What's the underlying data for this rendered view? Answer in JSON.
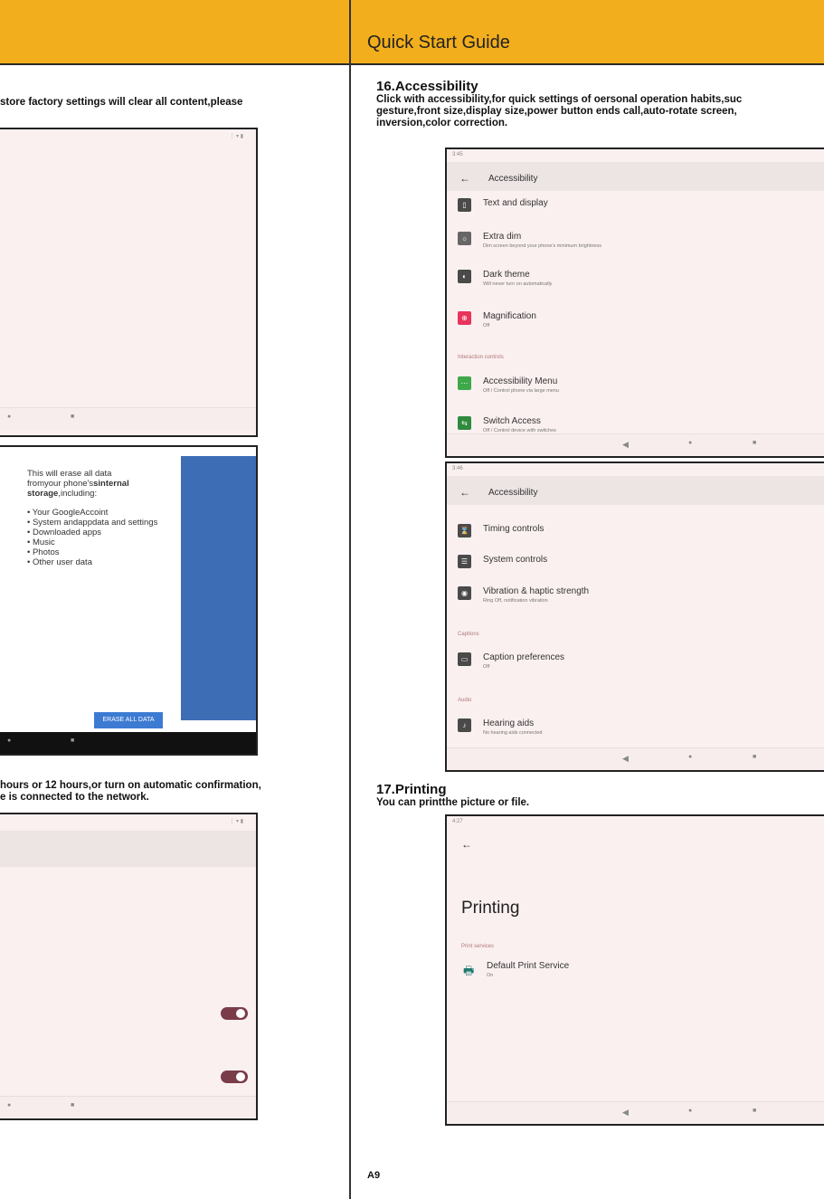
{
  "header": {
    "right_title": "Quick Start Guide"
  },
  "left": {
    "top_text": "store factory settings will clear all content,please",
    "erase": {
      "intro_line1": "This will erase all data",
      "intro_line2": "fromyour phone's",
      "intro_bold": "sinternal storage",
      "intro_tail": ",including:",
      "bullets": [
        "Your GoogleAccoint",
        "System andappdata and settings",
        "Downloaded apps",
        "Music",
        "Photos",
        "Other user data"
      ],
      "button": "ERASE ALL DATA"
    },
    "mid_text_line1": "hours or 12 hours,or turn on automatic confirmation,",
    "mid_text_line2": "e is connected to the network."
  },
  "s16": {
    "heading": "16.Accessibility",
    "para_line1": "Click with accessibility,for quick settings of oersonal operation habits,suc",
    "para_line2": "gesture,front size,display size,power button ends call,auto-rotate screen,",
    "para_line3": "inversion,color correction.",
    "shot1": {
      "time": "3:45",
      "title": "Accessibility",
      "items": [
        {
          "title": "Text and display",
          "sub": ""
        },
        {
          "title": "Extra dim",
          "sub": "Dim screen beyond your phone's minimum brightness"
        },
        {
          "title": "Dark theme",
          "sub": "Will never turn on automatically"
        },
        {
          "title": "Magnification",
          "sub": "Off"
        },
        {
          "title": "Accessibility Menu",
          "sub": "Off / Control phone via large menu"
        },
        {
          "title": "Switch Access",
          "sub": "Off / Control device with switches"
        }
      ],
      "section": "Interaction controls"
    },
    "shot2": {
      "time": "3:46",
      "title": "Accessibility",
      "items": [
        {
          "title": "Timing controls",
          "sub": ""
        },
        {
          "title": "System controls",
          "sub": ""
        },
        {
          "title": "Vibration & haptic strength",
          "sub": "Ring Off, notification vibration"
        },
        {
          "title": "Caption preferences",
          "sub": "Off"
        },
        {
          "title": "Hearing aids",
          "sub": "No hearing aids connected"
        }
      ],
      "section_captions": "Captions",
      "section_audio": "Audio"
    }
  },
  "s17": {
    "heading": "17.Printing",
    "para": "You can printthe picture or file.",
    "shot": {
      "time": "4:27",
      "title": "Printing",
      "section": "Print services",
      "service_title": "Default Print Service",
      "service_sub": "On"
    }
  },
  "footer": {
    "page": "A9"
  },
  "glyphs": {
    "back": "←",
    "nav_back": "◀",
    "nav_home": "●",
    "nav_recent": "■"
  },
  "colors": {
    "header": "#f2ae1c",
    "accent_blue": "#3d6db5",
    "toggle": "#7a3c49"
  }
}
